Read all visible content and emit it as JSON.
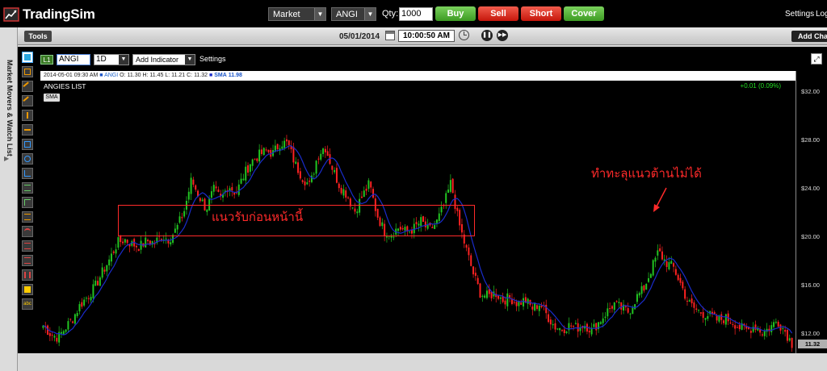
{
  "app": {
    "name": "TradingSim"
  },
  "topbar": {
    "order_type": "Market",
    "symbol": "ANGI",
    "qty_label": "Qty:",
    "qty_value": "1000",
    "buy_label": "Buy",
    "sell_label": "Sell",
    "short_label": "Short",
    "cover_label": "Cover",
    "settings_label": "Settings",
    "logout_label": "Log"
  },
  "secbar": {
    "tools_label": "Tools",
    "date": "05/01/2014",
    "time": "10:00:50 AM",
    "add_chart_label": "Add Chart"
  },
  "sidebar": {
    "label": "Market Movers & Watch List"
  },
  "chart_toolbar": {
    "layout_badge": "L1",
    "symbol": "ANGI",
    "timeframe": "1D",
    "add_indicator_label": "Add Indicator",
    "settings_label": "Settings"
  },
  "infobar": {
    "datetime": "2014-05-01 09:30 AM",
    "symbol": "ANGI",
    "o_label": "O:",
    "o": "11.30",
    "h_label": "H:",
    "h": "11.45",
    "l_label": "L:",
    "l": "11.21",
    "c_label": "C:",
    "c": "11.32",
    "sma_label": "SMA",
    "sma": "11.98"
  },
  "chart": {
    "title": "ANGIES LIST",
    "sma_badge": "SMA",
    "change": "+0.01 (0.09%)",
    "last_price": "11.32",
    "annotations": {
      "support_text": "แนวรับก่อนหน้านี้",
      "resistance_text": "ทำทะลุแนวต้านไม่ได้"
    },
    "colors": {
      "up": "#22c522",
      "down": "#ff2222",
      "sma": "#1a2ccc",
      "annotation": "#ff2a2a"
    }
  },
  "chart_data": {
    "type": "candlestick",
    "y_ticks": [
      "$32.00",
      "$28.00",
      "$24.00",
      "$20.00",
      "$16.00",
      "$12.00"
    ],
    "ylim": [
      10.5,
      33.0
    ],
    "close_path": [
      12.8,
      12.1,
      11.8,
      12.6,
      13.4,
      14.5,
      15.2,
      16.0,
      17.2,
      18.3,
      19.6,
      19.9,
      19.5,
      19.3,
      19.8,
      19.6,
      20.2,
      19.9,
      20.8,
      22.2,
      24.8,
      23.5,
      22.4,
      24.0,
      23.2,
      24.4,
      23.7,
      25.1,
      26.3,
      26.8,
      27.2,
      27.0,
      27.9,
      27.8,
      26.1,
      25.0,
      24.3,
      26.8,
      27.6,
      25.8,
      24.3,
      23.6,
      22.2,
      23.4,
      24.5,
      22.0,
      20.6,
      20.4,
      20.9,
      20.5,
      20.8,
      21.4,
      20.6,
      21.2,
      22.6,
      24.6,
      21.4,
      19.2,
      17.1,
      15.4,
      15.2,
      15.5,
      14.9,
      15.1,
      14.6,
      14.9,
      14.2,
      14.6,
      13.6,
      12.7,
      12.5,
      12.8,
      12.6,
      12.9,
      12.4,
      13.1,
      13.9,
      14.6,
      14.2,
      13.9,
      15.1,
      15.8,
      17.4,
      18.9,
      18.0,
      17.6,
      16.2,
      14.7,
      14.1,
      13.8,
      13.6,
      13.2,
      13.4,
      13.1,
      12.6,
      12.4,
      12.8,
      12.2,
      12.6,
      13.2,
      12.4,
      11.3
    ]
  }
}
